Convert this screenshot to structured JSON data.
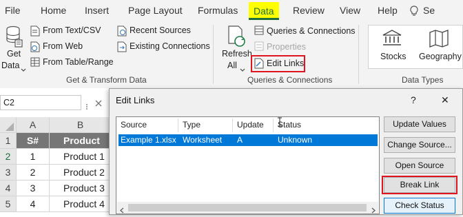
{
  "tabs": [
    {
      "label": "File",
      "active": false
    },
    {
      "label": "Home",
      "active": false
    },
    {
      "label": "Insert",
      "active": false
    },
    {
      "label": "Page Layout",
      "active": false
    },
    {
      "label": "Formulas",
      "active": false
    },
    {
      "label": "Data",
      "active": true
    },
    {
      "label": "Review",
      "active": false
    },
    {
      "label": "View",
      "active": false
    },
    {
      "label": "Help",
      "active": false
    },
    {
      "label": "Se",
      "active": false
    }
  ],
  "ribbon": {
    "get_data": {
      "line1": "Get",
      "line2": "Data"
    },
    "from_text_csv": "From Text/CSV",
    "from_web": "From Web",
    "from_table_range": "From Table/Range",
    "recent_sources": "Recent Sources",
    "existing_connections": "Existing Connections",
    "group_get_transform": "Get & Transform Data",
    "refresh": {
      "line1": "Refresh",
      "line2": "All"
    },
    "queries_connections": "Queries & Connections",
    "properties": "Properties",
    "edit_links": "Edit Links",
    "group_queries": "Queries & Connections",
    "stocks": "Stocks",
    "geography": "Geography",
    "group_data_types": "Data Types"
  },
  "formula_bar": {
    "name_box": "C2"
  },
  "sheet": {
    "col_headers": [
      "A",
      "B"
    ],
    "row_headers": [
      "1",
      "2",
      "3",
      "4",
      "5"
    ],
    "col_a": [
      "S#",
      "1",
      "2",
      "3",
      "4"
    ],
    "col_b": [
      "Product",
      "Product 1",
      "Product 2",
      "Product 3",
      "Product 4"
    ]
  },
  "dialog": {
    "title": "Edit Links",
    "help": "?",
    "close": "✕",
    "columns": [
      "Source",
      "Type",
      "Update",
      "Status"
    ],
    "rows": [
      {
        "source": "Example 1.xlsx",
        "type": "Worksheet",
        "update": "A",
        "status": "Unknown"
      }
    ],
    "buttons": {
      "update_values": "Update Values",
      "change_source": "Change Source...",
      "open_source": "Open Source",
      "break_link": "Break Link",
      "check_status": "Check Status"
    }
  },
  "colors": {
    "highlight": "#ffff00",
    "excel_green": "#1e6e3c",
    "annotation_red": "#e0141e",
    "selection_blue": "#0078d7",
    "header_dark": "#767676"
  }
}
